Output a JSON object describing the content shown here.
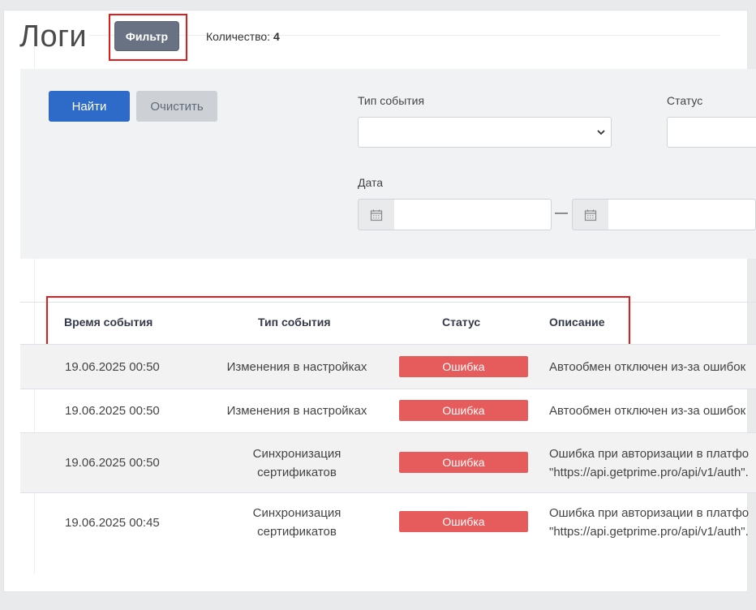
{
  "header": {
    "title": "Логи",
    "filter_button": "Фильтр",
    "count_label": "Количество:",
    "count_value": "4"
  },
  "filters": {
    "find_button": "Найти",
    "clear_button": "Очистить",
    "event_type_label": "Тип события",
    "event_type_value": "",
    "status_label": "Статус",
    "status_value": "",
    "date_label": "Дата",
    "date_from": "",
    "date_to": "",
    "date_separator": "—"
  },
  "table": {
    "columns": [
      "Время события",
      "Тип события",
      "Статус",
      "Описание"
    ],
    "rows": [
      {
        "time": "19.06.2025 00:50",
        "type": [
          "Изменения в настройках"
        ],
        "status": "Ошибка",
        "description": [
          "Автообмен отключен из-за ошибок"
        ]
      },
      {
        "time": "19.06.2025 00:50",
        "type": [
          "Изменения в настройках"
        ],
        "status": "Ошибка",
        "description": [
          "Автообмен отключен из-за ошибок"
        ]
      },
      {
        "time": "19.06.2025 00:50",
        "type": [
          "Синхронизация",
          "сертификатов"
        ],
        "status": "Ошибка",
        "description": [
          "Ошибка при авторизации в платфо",
          "\"https://api.getprime.pro/api/v1/auth\"."
        ]
      },
      {
        "time": "19.06.2025 00:45",
        "type": [
          "Синхронизация",
          "сертификатов"
        ],
        "status": "Ошибка",
        "description": [
          "Ошибка при авторизации в платфо",
          "\"https://api.getprime.pro/api/v1/auth\"."
        ]
      }
    ]
  },
  "icons": {
    "calendar": "calendar-icon",
    "chevron": "chevron-down-icon"
  },
  "colors": {
    "primary": "#2e6bc9",
    "filter_button": "#687282",
    "error_badge": "#e65b5b",
    "highlight": "#e41b1b"
  }
}
